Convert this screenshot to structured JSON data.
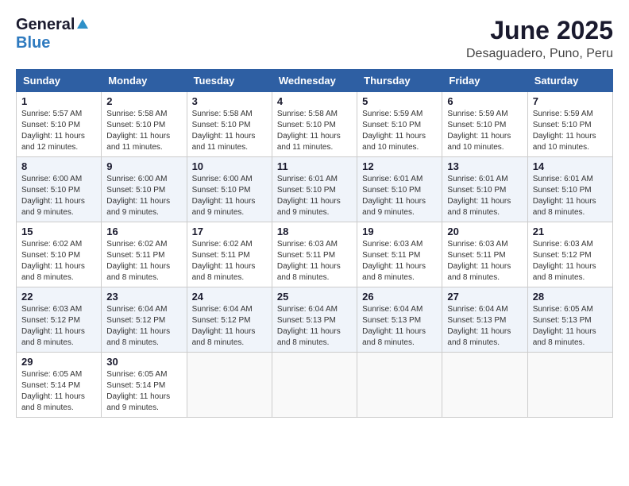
{
  "header": {
    "logo_general": "General",
    "logo_blue": "Blue",
    "month_year": "June 2025",
    "location": "Desaguadero, Puno, Peru"
  },
  "weekdays": [
    "Sunday",
    "Monday",
    "Tuesday",
    "Wednesday",
    "Thursday",
    "Friday",
    "Saturday"
  ],
  "weeks": [
    [
      {
        "day": "1",
        "sunrise": "Sunrise: 5:57 AM",
        "sunset": "Sunset: 5:10 PM",
        "daylight": "Daylight: 11 hours and 12 minutes."
      },
      {
        "day": "2",
        "sunrise": "Sunrise: 5:58 AM",
        "sunset": "Sunset: 5:10 PM",
        "daylight": "Daylight: 11 hours and 11 minutes."
      },
      {
        "day": "3",
        "sunrise": "Sunrise: 5:58 AM",
        "sunset": "Sunset: 5:10 PM",
        "daylight": "Daylight: 11 hours and 11 minutes."
      },
      {
        "day": "4",
        "sunrise": "Sunrise: 5:58 AM",
        "sunset": "Sunset: 5:10 PM",
        "daylight": "Daylight: 11 hours and 11 minutes."
      },
      {
        "day": "5",
        "sunrise": "Sunrise: 5:59 AM",
        "sunset": "Sunset: 5:10 PM",
        "daylight": "Daylight: 11 hours and 10 minutes."
      },
      {
        "day": "6",
        "sunrise": "Sunrise: 5:59 AM",
        "sunset": "Sunset: 5:10 PM",
        "daylight": "Daylight: 11 hours and 10 minutes."
      },
      {
        "day": "7",
        "sunrise": "Sunrise: 5:59 AM",
        "sunset": "Sunset: 5:10 PM",
        "daylight": "Daylight: 11 hours and 10 minutes."
      }
    ],
    [
      {
        "day": "8",
        "sunrise": "Sunrise: 6:00 AM",
        "sunset": "Sunset: 5:10 PM",
        "daylight": "Daylight: 11 hours and 9 minutes."
      },
      {
        "day": "9",
        "sunrise": "Sunrise: 6:00 AM",
        "sunset": "Sunset: 5:10 PM",
        "daylight": "Daylight: 11 hours and 9 minutes."
      },
      {
        "day": "10",
        "sunrise": "Sunrise: 6:00 AM",
        "sunset": "Sunset: 5:10 PM",
        "daylight": "Daylight: 11 hours and 9 minutes."
      },
      {
        "day": "11",
        "sunrise": "Sunrise: 6:01 AM",
        "sunset": "Sunset: 5:10 PM",
        "daylight": "Daylight: 11 hours and 9 minutes."
      },
      {
        "day": "12",
        "sunrise": "Sunrise: 6:01 AM",
        "sunset": "Sunset: 5:10 PM",
        "daylight": "Daylight: 11 hours and 9 minutes."
      },
      {
        "day": "13",
        "sunrise": "Sunrise: 6:01 AM",
        "sunset": "Sunset: 5:10 PM",
        "daylight": "Daylight: 11 hours and 8 minutes."
      },
      {
        "day": "14",
        "sunrise": "Sunrise: 6:01 AM",
        "sunset": "Sunset: 5:10 PM",
        "daylight": "Daylight: 11 hours and 8 minutes."
      }
    ],
    [
      {
        "day": "15",
        "sunrise": "Sunrise: 6:02 AM",
        "sunset": "Sunset: 5:10 PM",
        "daylight": "Daylight: 11 hours and 8 minutes."
      },
      {
        "day": "16",
        "sunrise": "Sunrise: 6:02 AM",
        "sunset": "Sunset: 5:11 PM",
        "daylight": "Daylight: 11 hours and 8 minutes."
      },
      {
        "day": "17",
        "sunrise": "Sunrise: 6:02 AM",
        "sunset": "Sunset: 5:11 PM",
        "daylight": "Daylight: 11 hours and 8 minutes."
      },
      {
        "day": "18",
        "sunrise": "Sunrise: 6:03 AM",
        "sunset": "Sunset: 5:11 PM",
        "daylight": "Daylight: 11 hours and 8 minutes."
      },
      {
        "day": "19",
        "sunrise": "Sunrise: 6:03 AM",
        "sunset": "Sunset: 5:11 PM",
        "daylight": "Daylight: 11 hours and 8 minutes."
      },
      {
        "day": "20",
        "sunrise": "Sunrise: 6:03 AM",
        "sunset": "Sunset: 5:11 PM",
        "daylight": "Daylight: 11 hours and 8 minutes."
      },
      {
        "day": "21",
        "sunrise": "Sunrise: 6:03 AM",
        "sunset": "Sunset: 5:12 PM",
        "daylight": "Daylight: 11 hours and 8 minutes."
      }
    ],
    [
      {
        "day": "22",
        "sunrise": "Sunrise: 6:03 AM",
        "sunset": "Sunset: 5:12 PM",
        "daylight": "Daylight: 11 hours and 8 minutes."
      },
      {
        "day": "23",
        "sunrise": "Sunrise: 6:04 AM",
        "sunset": "Sunset: 5:12 PM",
        "daylight": "Daylight: 11 hours and 8 minutes."
      },
      {
        "day": "24",
        "sunrise": "Sunrise: 6:04 AM",
        "sunset": "Sunset: 5:12 PM",
        "daylight": "Daylight: 11 hours and 8 minutes."
      },
      {
        "day": "25",
        "sunrise": "Sunrise: 6:04 AM",
        "sunset": "Sunset: 5:13 PM",
        "daylight": "Daylight: 11 hours and 8 minutes."
      },
      {
        "day": "26",
        "sunrise": "Sunrise: 6:04 AM",
        "sunset": "Sunset: 5:13 PM",
        "daylight": "Daylight: 11 hours and 8 minutes."
      },
      {
        "day": "27",
        "sunrise": "Sunrise: 6:04 AM",
        "sunset": "Sunset: 5:13 PM",
        "daylight": "Daylight: 11 hours and 8 minutes."
      },
      {
        "day": "28",
        "sunrise": "Sunrise: 6:05 AM",
        "sunset": "Sunset: 5:13 PM",
        "daylight": "Daylight: 11 hours and 8 minutes."
      }
    ],
    [
      {
        "day": "29",
        "sunrise": "Sunrise: 6:05 AM",
        "sunset": "Sunset: 5:14 PM",
        "daylight": "Daylight: 11 hours and 8 minutes."
      },
      {
        "day": "30",
        "sunrise": "Sunrise: 6:05 AM",
        "sunset": "Sunset: 5:14 PM",
        "daylight": "Daylight: 11 hours and 9 minutes."
      },
      null,
      null,
      null,
      null,
      null
    ]
  ]
}
